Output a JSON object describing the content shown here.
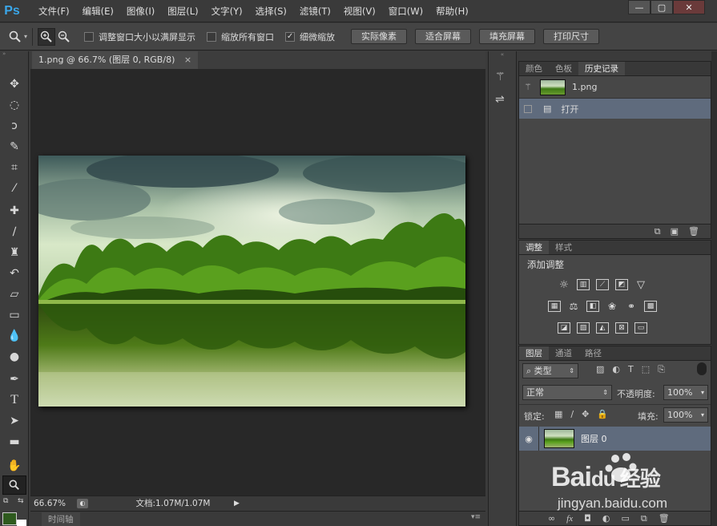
{
  "app": {
    "logo": "Ps"
  },
  "menu": [
    "文件(F)",
    "编辑(E)",
    "图像(I)",
    "图层(L)",
    "文字(Y)",
    "选择(S)",
    "滤镜(T)",
    "视图(V)",
    "窗口(W)",
    "帮助(H)"
  ],
  "window_controls": [
    "—",
    "▢",
    "✕"
  ],
  "options": {
    "checkbox1": {
      "label": "调整窗口大小以满屏显示",
      "checked": false
    },
    "checkbox2": {
      "label": "缩放所有窗口",
      "checked": false
    },
    "checkbox3": {
      "label": "细微缩放",
      "checked": true
    },
    "buttons": [
      "实际像素",
      "适合屏幕",
      "填充屏幕",
      "打印尺寸"
    ]
  },
  "document": {
    "tab_title": "1.png @ 66.7% (图层 0, RGB/8)",
    "close": "×"
  },
  "status": {
    "zoom": "66.67%",
    "doc_info": "文档:1.07M/1.07M"
  },
  "timeline_tab": "时间轴",
  "history_panel": {
    "tabs": [
      "颜色",
      "色板",
      "历史记录"
    ],
    "active_tab": 2,
    "snapshot_label": "1.png",
    "items": [
      {
        "label": "打开"
      }
    ]
  },
  "adjust_panel": {
    "tabs": [
      "调整",
      "样式"
    ],
    "active_tab": 0,
    "title": "添加调整"
  },
  "layers_panel": {
    "tabs": [
      "图层",
      "通道",
      "路径"
    ],
    "active_tab": 0,
    "filter_label": "类型",
    "blend_mode": "正常",
    "opacity_label": "不透明度:",
    "opacity": "100%",
    "lock_label": "锁定:",
    "fill_label": "填充:",
    "fill": "100%",
    "layers": [
      {
        "name": "图层 0",
        "visible": true
      }
    ]
  },
  "watermark": {
    "brand": "Bai",
    "paw": "du",
    "suffix": "经验",
    "url": "jingyan.baidu.com"
  },
  "colors": {
    "accent": "#3aa7ea",
    "selection": "#5f6b7d",
    "foreground": "#2e5a1e",
    "background": "#ffffff"
  }
}
